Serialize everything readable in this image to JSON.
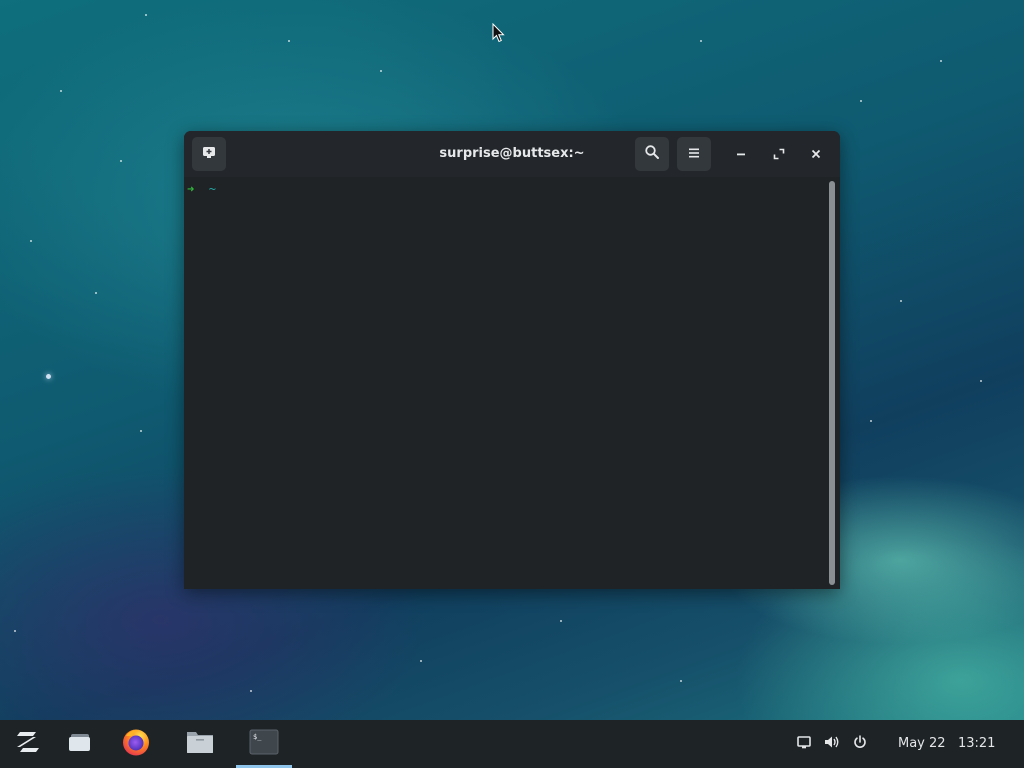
{
  "desktop": {
    "wallpaper": "aurora-teal-night-sky"
  },
  "terminal": {
    "title": "surprise@buttsex:~",
    "prompt_arrow": "➜",
    "prompt_dir": "~",
    "titlebar_buttons": {
      "new_tab_icon": "new-tab-icon",
      "search_icon": "search-icon",
      "menu_icon": "hamburger-menu-icon",
      "minimize_icon": "minimize-icon",
      "maximize_icon": "maximize-icon",
      "close_icon": "close-icon"
    },
    "colors": {
      "background": "#1f2326",
      "prompt_arrow": "#2fb73a",
      "prompt_dir": "#23a7a3"
    }
  },
  "taskbar": {
    "items": [
      {
        "name": "zorin-menu",
        "icon": "zorin-logo-icon"
      },
      {
        "name": "workspaces",
        "icon": "workspace-switcher-icon"
      },
      {
        "name": "firefox",
        "icon": "firefox-icon"
      },
      {
        "name": "files",
        "icon": "folder-icon"
      },
      {
        "name": "terminal",
        "icon": "terminal-icon",
        "active": true
      }
    ],
    "tray": {
      "icons": [
        "screen-icon",
        "volume-icon",
        "power-icon"
      ]
    },
    "clock": {
      "date": "May 22",
      "time": "13:21"
    },
    "colors": {
      "background": "#1e2326",
      "active_indicator": "#8fc5ea"
    }
  }
}
